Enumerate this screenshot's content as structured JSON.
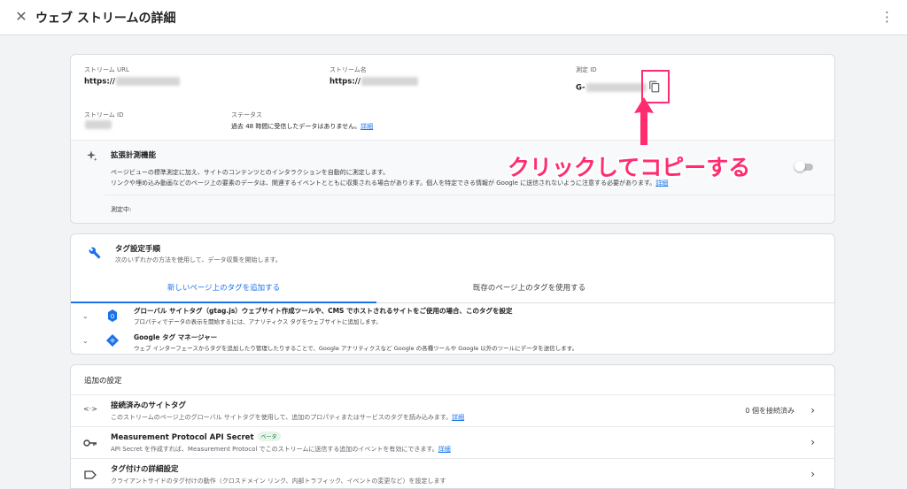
{
  "header": {
    "close_icon": "close-icon",
    "title": "ウェブ ストリームの詳細",
    "more_icon": "more-vert-icon"
  },
  "stream": {
    "url_label": "ストリーム URL",
    "url_value": "https://",
    "name_label": "ストリーム名",
    "name_value": "https://",
    "mid_label": "測定 ID",
    "mid_value": "G-",
    "sid_label": "ストリーム ID",
    "status_label": "ステータス",
    "status_text": "過去 48 時間に受信したデータはありません。",
    "status_link": "詳細"
  },
  "enhanced": {
    "title": "拡張計測機能",
    "desc1": "ページビューの標準測定に加え、サイトのコンテンツとのインタラクションを自動的に測定します。",
    "desc2": "リンクや埋め込み動画などのページ上の要素のデータは、関連するイベントとともに収集される場合があります。個人を特定できる情報が Google に送信されないように注意する必要があります。",
    "desc2_link": "詳細",
    "measuring": "測定中:",
    "toggle_on": false
  },
  "annotation": "クリックしてコピーする",
  "tagging": {
    "title": "タグ設定手順",
    "subtitle": "次のいずれかの方法を使用して、データ収集を開始します。",
    "tabs": [
      "新しいページ上のタグを追加する",
      "既存のページ上のタグを使用する"
    ],
    "items": [
      {
        "title": "グローバル サイトタグ（gtag.js）ウェブサイト作成ツールや、CMS でホストされるサイトをご使用の場合、このタグを設定",
        "desc": "プロパティでデータの表示を開始するには、アナリティクス タグをウェブサイトに追加します。"
      },
      {
        "title": "Google タグ マネージャー",
        "desc": "ウェブ インターフェースからタグを追加したり管理したりすることで、Google アナリティクスなど Google の各種ツールや Google 以外のツールにデータを送信します。"
      }
    ]
  },
  "settings": {
    "title": "追加の設定",
    "rows": [
      {
        "title": "接続済みのサイトタグ",
        "desc": "このストリームのページ上のグローバル サイトタグを使用して、追加のプロパティまたはサービスのタグを読み込みます。",
        "link": "詳細",
        "right": "0 個を接続済み"
      },
      {
        "title": "Measurement Protocol API Secret",
        "badge": "ベータ",
        "desc": "API Secret を作成すれば、Measurement Protocol でこのストリームに送信する追加のイベントを有効にできます。",
        "link": "詳細"
      },
      {
        "title": "タグ付けの詳細設定",
        "desc": "クライアントサイドのタグ付けの動作（クロスドメイン リンク、内部トラフィック、イベントの変更など）を設定します"
      }
    ]
  },
  "colors": {
    "accent": "#1a73e8",
    "annotation": "#ff2d6f"
  }
}
